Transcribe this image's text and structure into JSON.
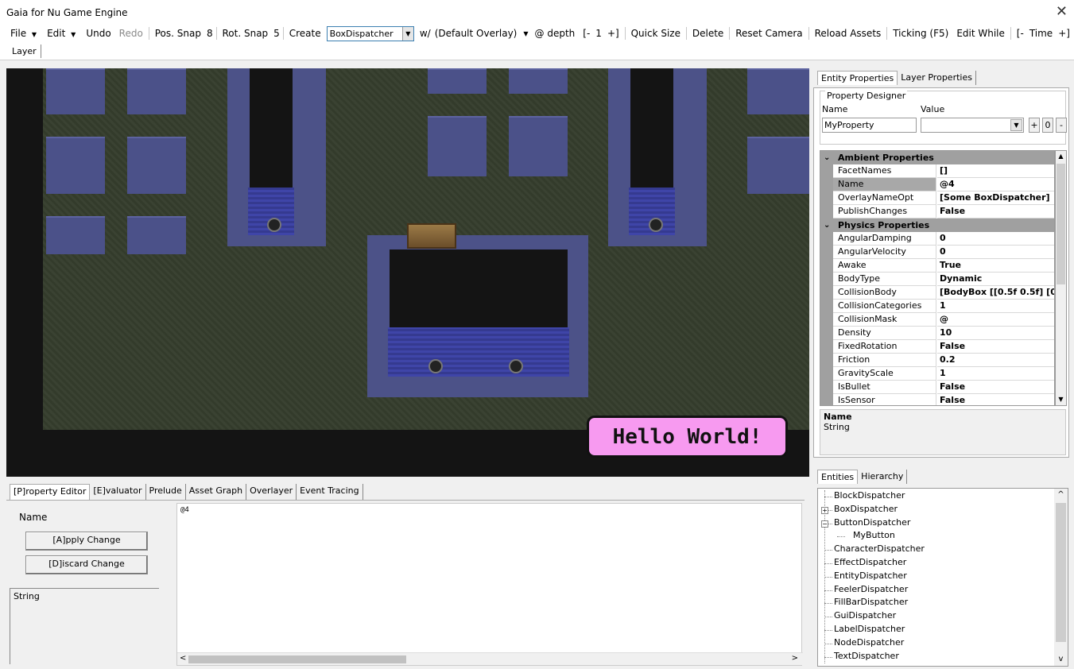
{
  "window": {
    "title": "Gaia for Nu Game Engine",
    "close_glyph": "✕"
  },
  "toolbar": {
    "file": "File",
    "edit": "Edit",
    "undo": "Undo",
    "redo": "Redo",
    "pos_snap_label": "Pos. Snap",
    "pos_snap_value": "8",
    "rot_snap_label": "Rot. Snap",
    "rot_snap_value": "5",
    "create": "Create",
    "create_dispatcher": "BoxDispatcher",
    "overlay_prefix": "w/",
    "overlay": "(Default Overlay)",
    "depth_label": "@ depth",
    "depth_minus": "[-",
    "depth_value": "1",
    "depth_plus": "+]",
    "quick_size": "Quick Size",
    "delete": "Delete",
    "reset_camera": "Reset Camera",
    "reload_assets": "Reload Assets",
    "ticking": "Ticking (F5)",
    "edit_while": "Edit While",
    "time_minus": "[-",
    "time_label": "Time",
    "time_plus": "+]"
  },
  "layer_tab": "Layer",
  "viewport": {
    "hello_text": "Hello World!"
  },
  "bottom_tabs": [
    "[P]roperty Editor",
    "[E]valuator",
    "Prelude",
    "Asset Graph",
    "Overlayer",
    "Event Tracing"
  ],
  "property_editor": {
    "name_label": "Name",
    "apply": "[A]pply Change",
    "discard": "[D]iscard Change",
    "type": "String",
    "text_value": "@4"
  },
  "right_tabs": [
    "Entity Properties",
    "Layer Properties"
  ],
  "designer": {
    "legend": "Property Designer",
    "name_header": "Name",
    "value_header": "Value",
    "name_value": "MyProperty",
    "plus": "+",
    "zero": "0",
    "minus": "-"
  },
  "grid": {
    "categories": [
      {
        "label": "Ambient Properties",
        "rows": [
          [
            "FacetNames",
            "[]"
          ],
          [
            "Name",
            "@4"
          ],
          [
            "OverlayNameOpt",
            "[Some BoxDispatcher]"
          ],
          [
            "PublishChanges",
            "False"
          ]
        ]
      },
      {
        "label": "Physics Properties",
        "rows": [
          [
            "AngularDamping",
            "0"
          ],
          [
            "AngularVelocity",
            "0"
          ],
          [
            "Awake",
            "True"
          ],
          [
            "BodyType",
            "Dynamic"
          ],
          [
            "CollisionBody",
            "[BodyBox [[0.5f 0.5f] [0."
          ],
          [
            "CollisionCategories",
            "1"
          ],
          [
            "CollisionMask",
            "@"
          ],
          [
            "Density",
            "10"
          ],
          [
            "FixedRotation",
            "False"
          ],
          [
            "Friction",
            "0.2"
          ],
          [
            "GravityScale",
            "1"
          ],
          [
            "IsBullet",
            "False"
          ],
          [
            "IsSensor",
            "False"
          ]
        ]
      }
    ],
    "selected": "Name"
  },
  "description": {
    "name": "Name",
    "type": "String"
  },
  "entity_tabs": [
    "Entities",
    "Hierarchy"
  ],
  "entities": [
    {
      "label": "BlockDispatcher",
      "depth": 0,
      "toggle": ""
    },
    {
      "label": "BoxDispatcher",
      "depth": 0,
      "toggle": "+"
    },
    {
      "label": "ButtonDispatcher",
      "depth": 0,
      "toggle": "−"
    },
    {
      "label": "MyButton",
      "depth": 1,
      "toggle": ""
    },
    {
      "label": "CharacterDispatcher",
      "depth": 0,
      "toggle": ""
    },
    {
      "label": "EffectDispatcher",
      "depth": 0,
      "toggle": ""
    },
    {
      "label": "EntityDispatcher",
      "depth": 0,
      "toggle": ""
    },
    {
      "label": "FeelerDispatcher",
      "depth": 0,
      "toggle": ""
    },
    {
      "label": "FillBarDispatcher",
      "depth": 0,
      "toggle": ""
    },
    {
      "label": "GuiDispatcher",
      "depth": 0,
      "toggle": ""
    },
    {
      "label": "LabelDispatcher",
      "depth": 0,
      "toggle": ""
    },
    {
      "label": "NodeDispatcher",
      "depth": 0,
      "toggle": ""
    },
    {
      "label": "TextDispatcher",
      "depth": 0,
      "toggle": ""
    }
  ],
  "colors": {
    "floor": "#343c2c",
    "tile": "#4b5189",
    "pit": "#141414",
    "brick": "#3f45a8",
    "label_bg": "#f79af0"
  },
  "icons": {
    "dropdown": "chevron-down-icon",
    "close": "close-icon",
    "collapse": "chevron-down-icon",
    "scroll_up": "chevron-up-icon",
    "scroll_down": "chevron-down-icon"
  }
}
